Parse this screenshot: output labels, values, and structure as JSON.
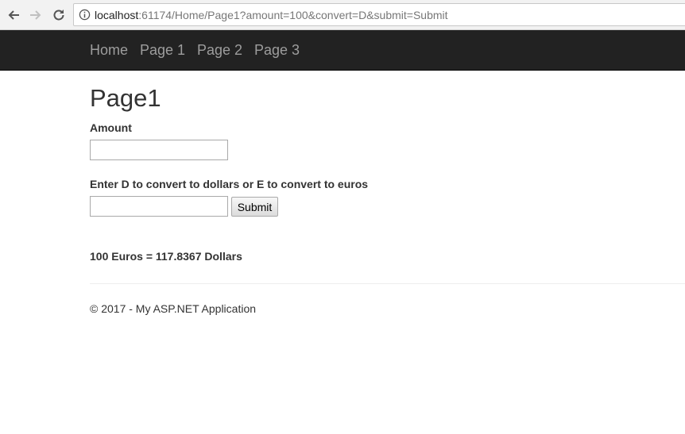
{
  "browser": {
    "url_host": "localhost",
    "url_rest": ":61174/Home/Page1?amount=100&convert=D&submit=Submit",
    "icons": {
      "back": "arrow-left-icon",
      "forward": "arrow-right-icon",
      "reload": "reload-icon",
      "info": "info-icon"
    }
  },
  "navbar": {
    "items": [
      {
        "label": "Home"
      },
      {
        "label": "Page 1"
      },
      {
        "label": "Page 2"
      },
      {
        "label": "Page 3"
      }
    ],
    "background": "#222222",
    "link_color": "#9d9d9d"
  },
  "main": {
    "title": "Page1",
    "amount_label": "Amount",
    "amount_value": "",
    "convert_label": "Enter D to convert to dollars or E to convert to euros",
    "convert_value": "",
    "submit_label": "Submit",
    "result": "100 Euros = 117.8367 Dollars"
  },
  "footer": {
    "text": "© 2017 - My ASP.NET Application"
  }
}
